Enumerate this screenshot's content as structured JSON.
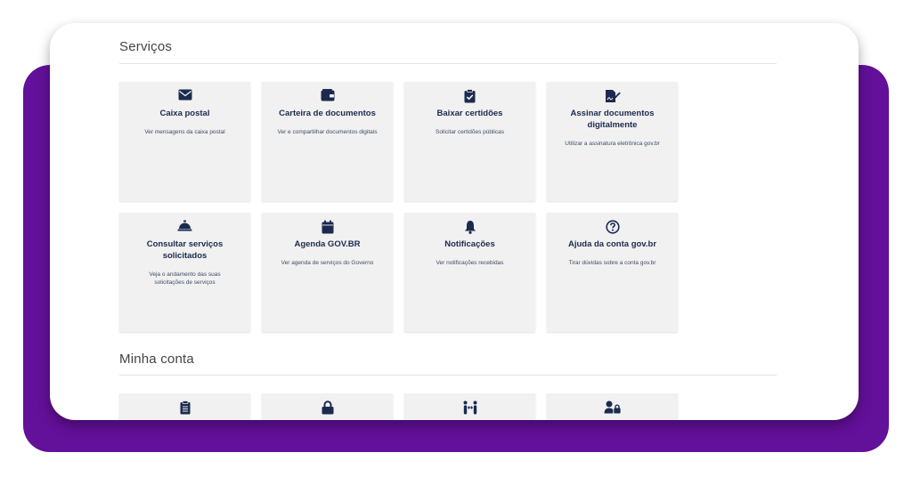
{
  "servicos": {
    "title": "Serviços",
    "cards": [
      {
        "icon": "envelope-icon",
        "title": "Caixa postal",
        "desc": "Ver mensagens da caixa postal"
      },
      {
        "icon": "wallet-icon",
        "title": "Carteira de documentos",
        "desc": "Ver e compartilhar documentos digitais"
      },
      {
        "icon": "clipboard-check-icon",
        "title": "Baixar certidões",
        "desc": "Solicitar certidões públicas"
      },
      {
        "icon": "signature-icon",
        "title": "Assinar documentos digitalmente",
        "desc": "Utilizar a assinatura eletrônica gov.br"
      },
      {
        "icon": "service-bell-icon",
        "title": "Consultar serviços solicitados",
        "desc": "Veja o andamento das suas solicitações de serviços"
      },
      {
        "icon": "calendar-icon",
        "title": "Agenda GOV.BR",
        "desc": "Ver agenda de serviços do Governo"
      },
      {
        "icon": "bell-icon",
        "title": "Notificações",
        "desc": "Ver notificações recebidas"
      },
      {
        "icon": "question-circle-icon",
        "title": "Ajuda da conta gov.br",
        "desc": "Tirar dúvidas sobre a conta gov.br"
      }
    ]
  },
  "minha_conta": {
    "title": "Minha conta",
    "cards": [
      {
        "icon": "clipboard-list-icon"
      },
      {
        "icon": "lock-icon"
      },
      {
        "icon": "people-exchange-icon"
      },
      {
        "icon": "user-lock-icon"
      }
    ]
  },
  "colors": {
    "purple_backdrop": "#63109a",
    "icon": "#1b2a4e",
    "card_bg": "#f1f1f1"
  }
}
